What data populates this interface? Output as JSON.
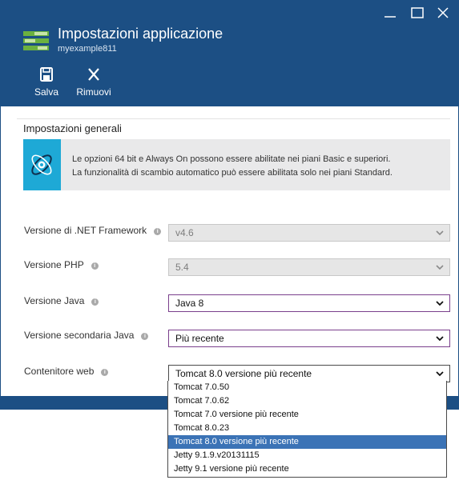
{
  "window": {
    "title": "Impostazioni applicazione",
    "subtitle": "myexample811",
    "controls": [
      "minimize-icon",
      "maximize-icon",
      "close-icon"
    ]
  },
  "toolbar": {
    "save_label": "Salva",
    "save_icon": "save-icon",
    "remove_label": "Rimuovi",
    "remove_icon": "x-icon"
  },
  "section": {
    "title": "Impostazioni generali"
  },
  "info": {
    "icon": "info-banner-icon",
    "line1": "Le opzioni 64 bit e Always On possono essere abilitate nei piani Basic e superiori.",
    "line2": "La funzionalità di scambio automatico può essere abilitata solo nei piani Standard."
  },
  "settings": [
    {
      "label": "Versione di .NET Framework",
      "value": "v4.6",
      "state": "disabled"
    },
    {
      "label": "Versione PHP",
      "value": "5.4",
      "state": "disabled"
    },
    {
      "label": "Versione Java",
      "value": "Java 8",
      "state": "enabled"
    },
    {
      "label": "Versione secondaria Java",
      "value": "Più recente",
      "state": "enabled"
    },
    {
      "label": "Contenitore web",
      "value": "Tomcat 8.0 versione più recente",
      "state": "open"
    }
  ],
  "dropdown": {
    "options": [
      "Tomcat 7.0.50",
      "Tomcat 7.0.62",
      "Tomcat 7.0 versione più recente",
      "Tomcat 8.0.23",
      "Tomcat 8.0 versione più recente",
      "Jetty 9.1.9.v20131115",
      "Jetty 9.1 versione più recente"
    ],
    "selected_index": 4
  },
  "colors": {
    "header": "#1c4f84",
    "info_accent": "#1ea9d6",
    "selection": "#3b73b6",
    "focus_border": "#7a3f8c"
  }
}
